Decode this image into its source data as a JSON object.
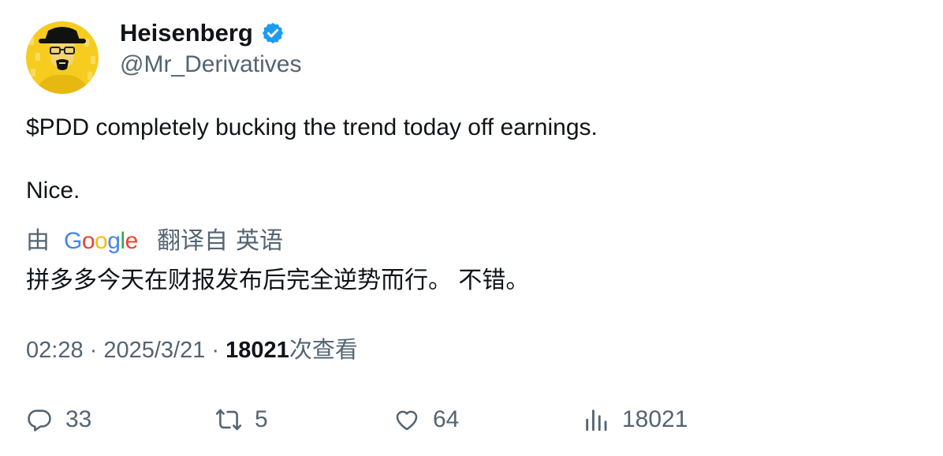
{
  "author": {
    "display_name": "Heisenberg",
    "handle": "@Mr_Derivatives",
    "verified_icon": "verified-badge-icon",
    "avatar_icon": "heisenberg-avatar"
  },
  "tweet": {
    "line1": "$PDD completely bucking the trend today off earnings.",
    "line2": "Nice."
  },
  "translation": {
    "by_label": "由",
    "provider_logo_text": "Google",
    "from_label": "翻译自",
    "language": "英语",
    "text": "拼多多今天在财报发布后完全逆势而行。 不错。"
  },
  "meta": {
    "time": "02:28",
    "separator": " · ",
    "date": "2025/3/21",
    "views_count": "18021",
    "views_label": "次查看"
  },
  "actions": {
    "replies": "33",
    "retweets": "5",
    "likes": "64",
    "views": "18021"
  },
  "colors": {
    "text": "#0f1419",
    "secondary": "#536471",
    "verified": "#1d9bf0",
    "avatar_bg": "#f6cc1f"
  }
}
